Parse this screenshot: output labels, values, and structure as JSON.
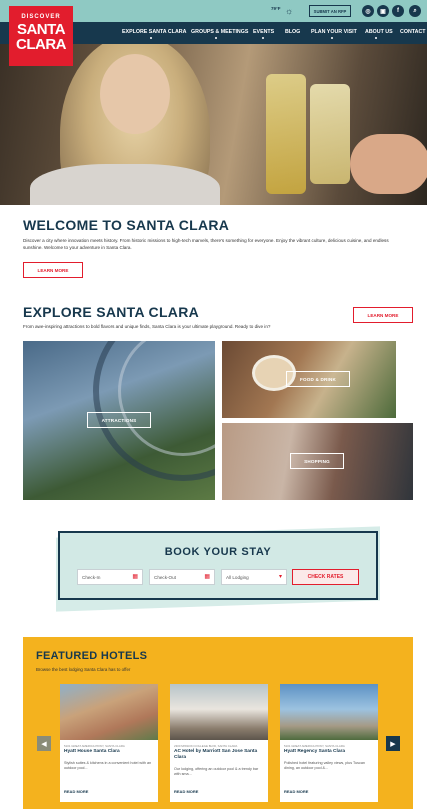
{
  "logo": {
    "line1": "DISCOVER",
    "line2": "SANTA",
    "line3": "CLARA"
  },
  "utility": {
    "weather_temp": "79°F",
    "submit_event_label": "SUBMIT AN RFP",
    "social": [
      "ig",
      "in",
      "fb",
      "search"
    ]
  },
  "nav": {
    "items": [
      "EXPLORE SANTA CLARA",
      "GROUPS & MEETINGS",
      "EVENTS",
      "BLOG",
      "PLAN YOUR VISIT",
      "ABOUT US",
      "CONTACT"
    ]
  },
  "welcome": {
    "title": "WELCOME TO SANTA CLARA",
    "body": "Discover a city where innovation meets history. From historic missions to high-tech marvels, there's something for everyone. Enjoy the vibrant culture, delicious cuisine, and endless sunshine. Welcome to your adventure in Santa Clara.",
    "button": "LEARN MORE"
  },
  "explore": {
    "title": "EXPLORE SANTA CLARA",
    "body": "From awe-inspiring attractions to bold flavors and unique finds, Santa Clara is your ultimate playground. Ready to dive in?",
    "button": "LEARN MORE",
    "tiles": [
      "ATTRACTIONS",
      "FOOD & DRINK",
      "SHOPPING"
    ]
  },
  "booking": {
    "title": "BOOK YOUR STAY",
    "check_in": "Check-In",
    "check_out": "Check-Out",
    "lodging": "All Lodging",
    "submit": "CHECK RATES"
  },
  "featured": {
    "title": "FEATURED HOTELS",
    "subtitle": "Browse the best lodging Santa Clara has to offer",
    "hotels": [
      {
        "meta": "5101 GREAT AMERICA PKWY, SANTA CLARA",
        "name": "Hyatt House Santa Clara",
        "desc": "Stylish suites & kitchens in a convenient hotel with an outdoor pool...",
        "more": "READ MORE"
      },
      {
        "meta": "2300 MISSION COLLEGE BLVD, SANTA CLARA",
        "name": "AC Hotel by Marriott San Jose Santa Clara",
        "desc": "Our lodging, offering an outdoor pool & a trendy bar with sma...",
        "more": "READ MORE"
      },
      {
        "meta": "5101 GREAT AMERICA PKWY, SANTA CLARA",
        "name": "Hyatt Regency Santa Clara",
        "desc": "Polished hotel featuring valley views, plus Tuscan dining, an outdoor pool &...",
        "more": "READ MORE"
      }
    ]
  },
  "colors": {
    "navy": "#17384d",
    "teal": "#8fc9c3",
    "red": "#e21d2d",
    "yellow": "#f4b21e"
  }
}
